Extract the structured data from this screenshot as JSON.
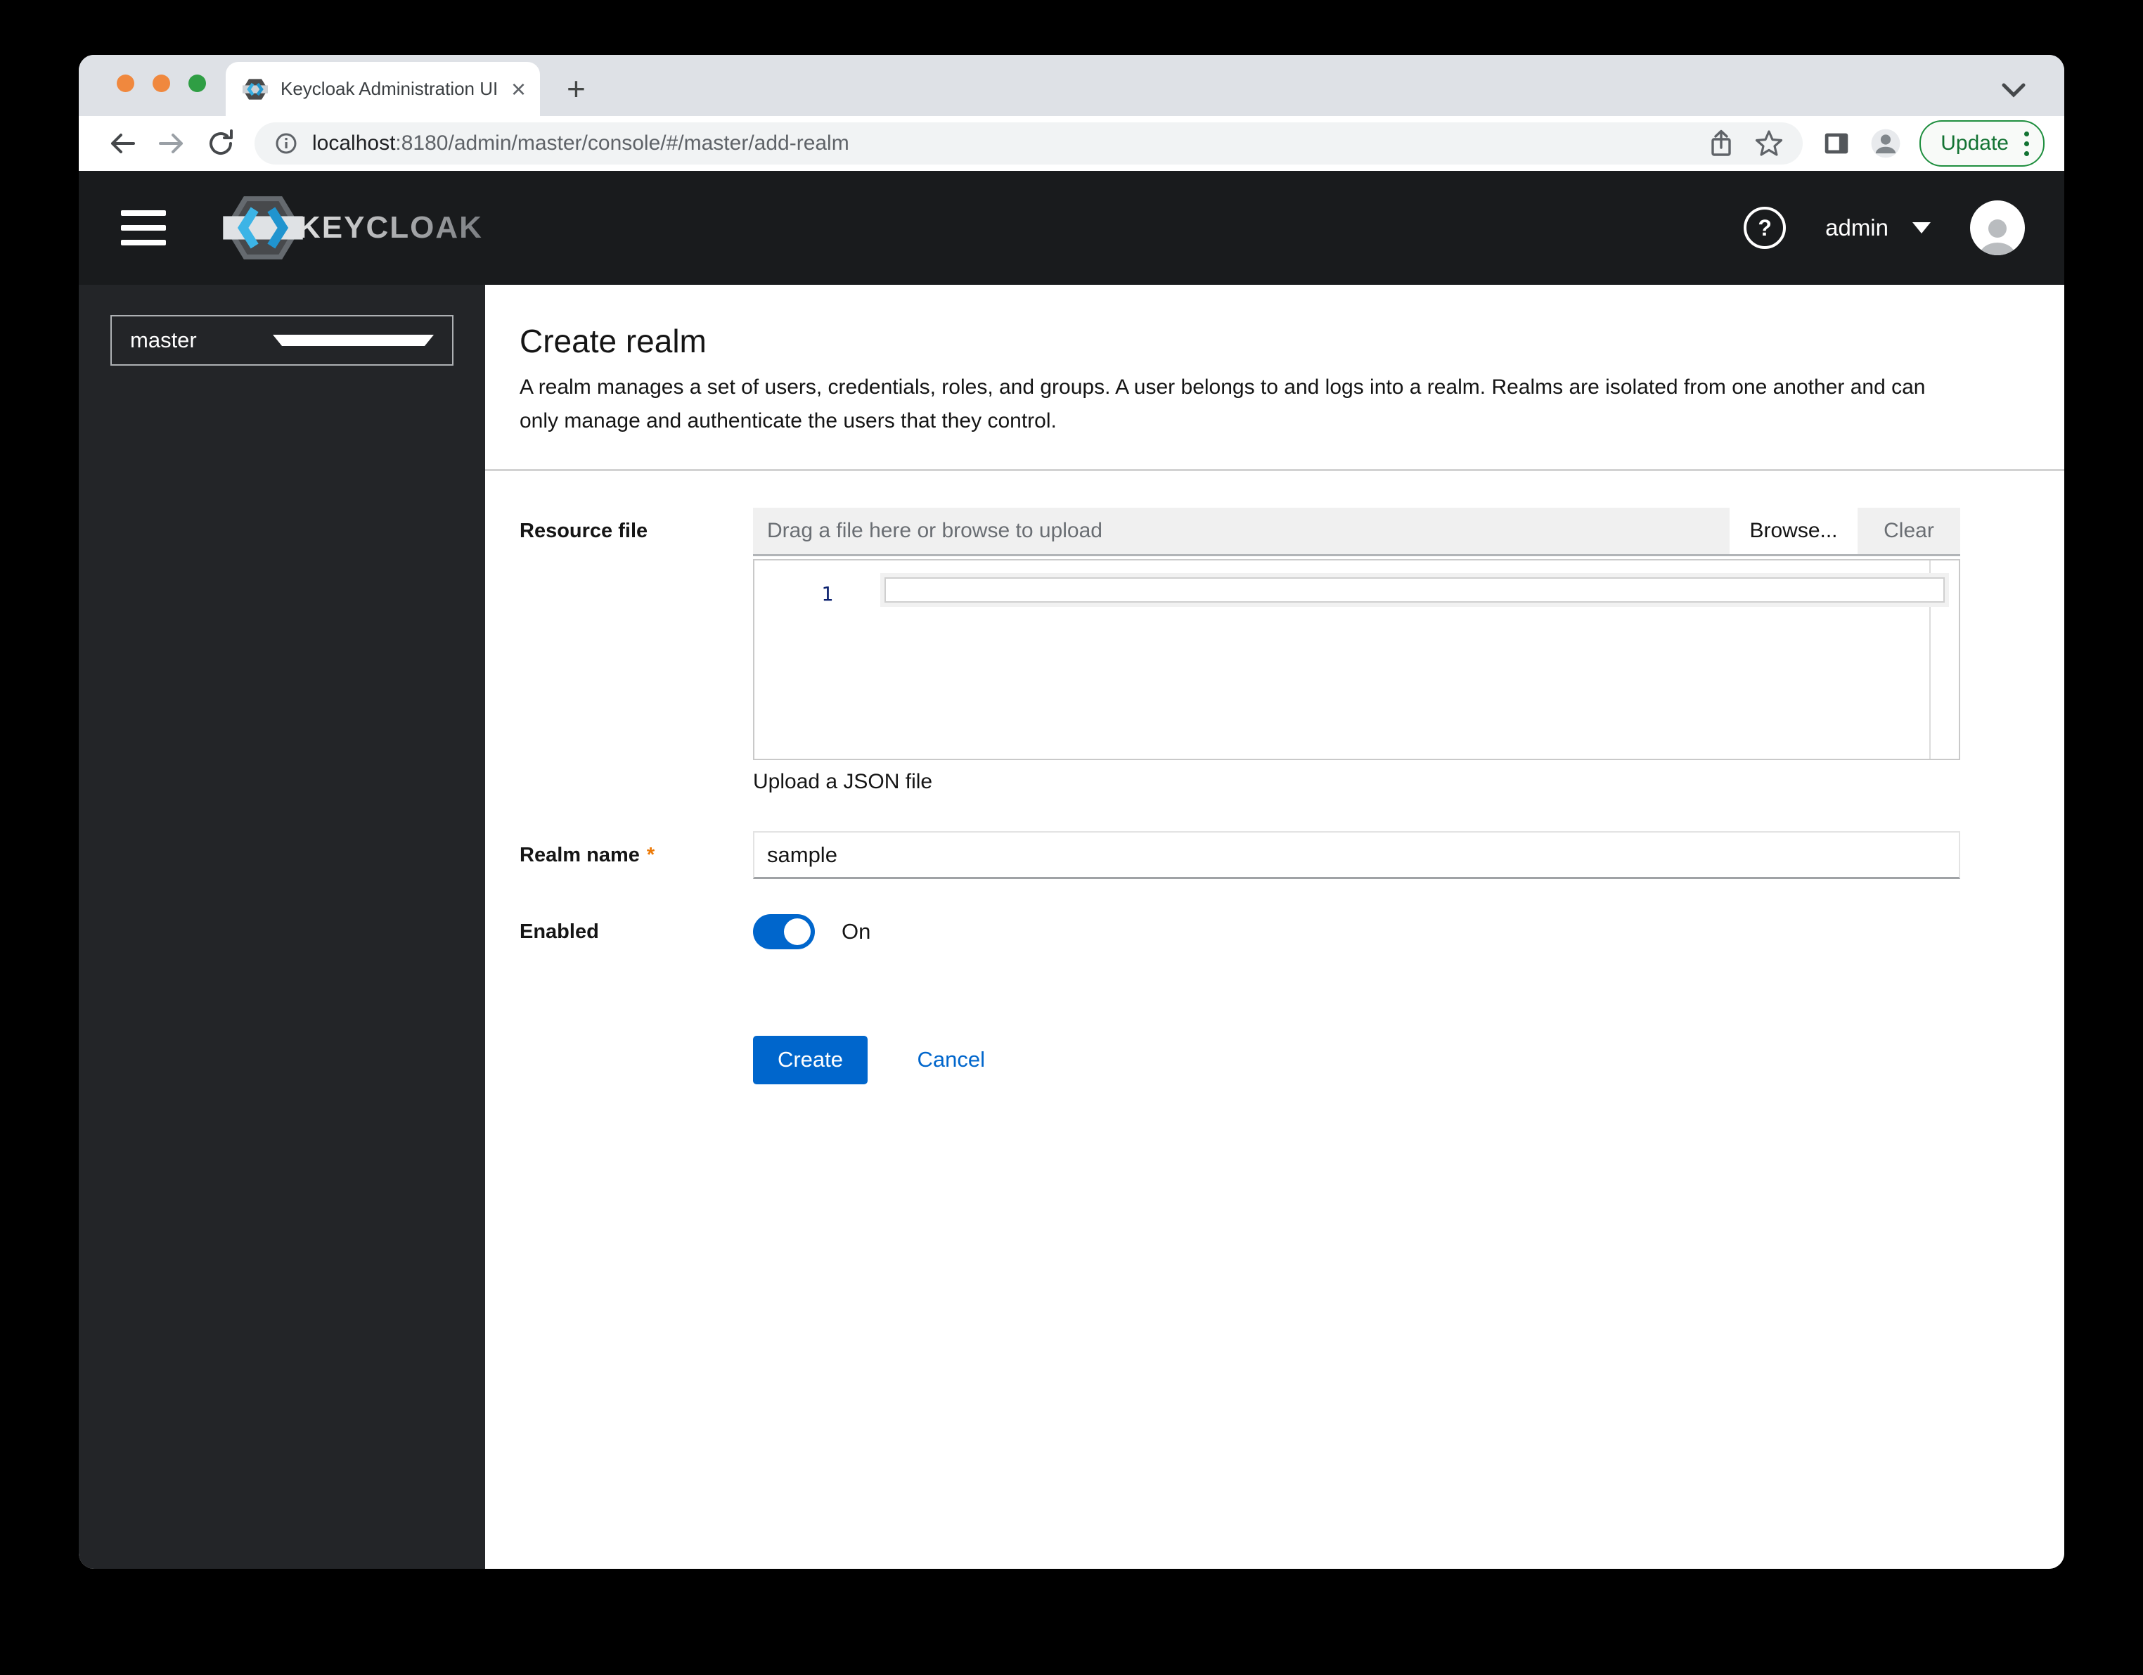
{
  "browser": {
    "tab": {
      "title": "Keycloak Administration UI"
    },
    "url": {
      "host": "localhost",
      "path": ":8180/admin/master/console/#/master/add-realm"
    },
    "update_button": {
      "label": "Update"
    }
  },
  "icons": {
    "close_glyph": "×",
    "new_tab_glyph": "+",
    "help_glyph": "?"
  },
  "header": {
    "brand": "KEYCLOAK",
    "user": {
      "name": "admin"
    }
  },
  "sidebar": {
    "realm_selector": {
      "value": "master"
    }
  },
  "main": {
    "title": "Create realm",
    "description": "A realm manages a set of users, credentials, roles, and groups. A user belongs to and logs into a realm. Realms are isolated from one another and can only manage and authenticate the users that they control.",
    "form": {
      "resource_file": {
        "label": "Resource file",
        "placeholder": "Drag a file here or browse to upload",
        "browse_label": "Browse...",
        "clear_label": "Clear",
        "editor": {
          "line_number": "1"
        },
        "helper_text": "Upload a JSON file"
      },
      "realm_name": {
        "label": "Realm name",
        "required_indicator": "*",
        "value": "sample"
      },
      "enabled": {
        "label": "Enabled",
        "state_label": "On"
      },
      "actions": {
        "create_label": "Create",
        "cancel_label": "Cancel"
      }
    }
  },
  "colors": {
    "accent": "#0066CC",
    "update_green": "#137333",
    "required": "#EC7A08",
    "masthead_bg": "#191B1D",
    "sidebar_bg": "#232528"
  }
}
